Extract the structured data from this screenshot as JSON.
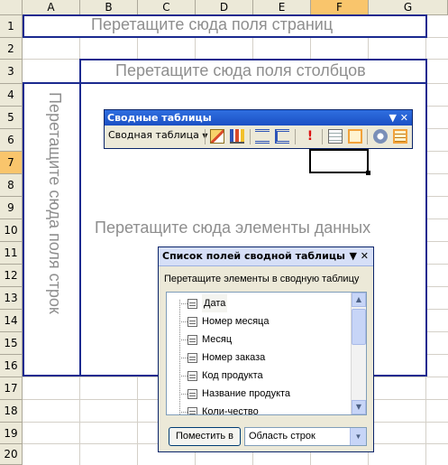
{
  "columns": [
    "A",
    "B",
    "C",
    "D",
    "E",
    "F",
    "G"
  ],
  "selected_column": "F",
  "rows": [
    "1",
    "2",
    "3",
    "4",
    "5",
    "6",
    "7",
    "8",
    "9",
    "10",
    "11",
    "12",
    "13",
    "14",
    "15",
    "16",
    "17",
    "18",
    "19",
    "20"
  ],
  "selected_row": "7",
  "drop_zones": {
    "page_fields": "Перетащите сюда поля страниц",
    "column_fields": "Перетащите сюда поля столбцов",
    "row_fields": "Перетащите сюда поля строк",
    "data_items": "Перетащите сюда элементы данных"
  },
  "toolbar": {
    "title": "Сводные таблицы",
    "menu_label": "Сводная таблица",
    "icons": [
      "format-report-icon",
      "chart-wizard-icon",
      "hide-detail-icon",
      "show-detail-icon",
      "refresh-data-icon",
      "field-settings-icon",
      "show-field-list-icon",
      "hide-items-icon",
      "always-display-items-icon"
    ]
  },
  "field_list": {
    "title": "Список полей сводной таблицы",
    "instruction": "Перетащите элементы в сводную таблицу",
    "items": [
      "Дата",
      "Номер месяца",
      "Месяц",
      "Номер заказа",
      "Код продукта",
      "Название продукта",
      "Коли-чество"
    ],
    "add_button": "Поместить в",
    "area_value": "Область строк"
  },
  "colors": {
    "dropzone_border": "#1b2a8f",
    "toolbar_title": "#2f6fe0",
    "selection_header": "#f9c56c"
  }
}
